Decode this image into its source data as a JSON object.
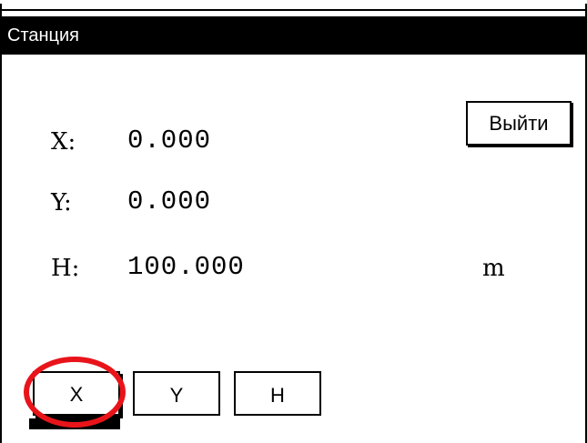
{
  "window": {
    "title": "Станция"
  },
  "coordinates": {
    "x_label": "X:",
    "x_value": "0.000",
    "y_label": "Y:",
    "y_value": "0.000",
    "h_label": "H:",
    "h_value": "100.000",
    "unit": "m"
  },
  "buttons": {
    "exit_label": "Выйти",
    "axis_x_label": "X",
    "axis_y_label": "Y",
    "axis_h_label": "H",
    "selected": "X"
  },
  "colors": {
    "titlebar_bg": "#000000",
    "titlebar_fg": "#ffffff",
    "highlight_ring": "#e8141a"
  }
}
